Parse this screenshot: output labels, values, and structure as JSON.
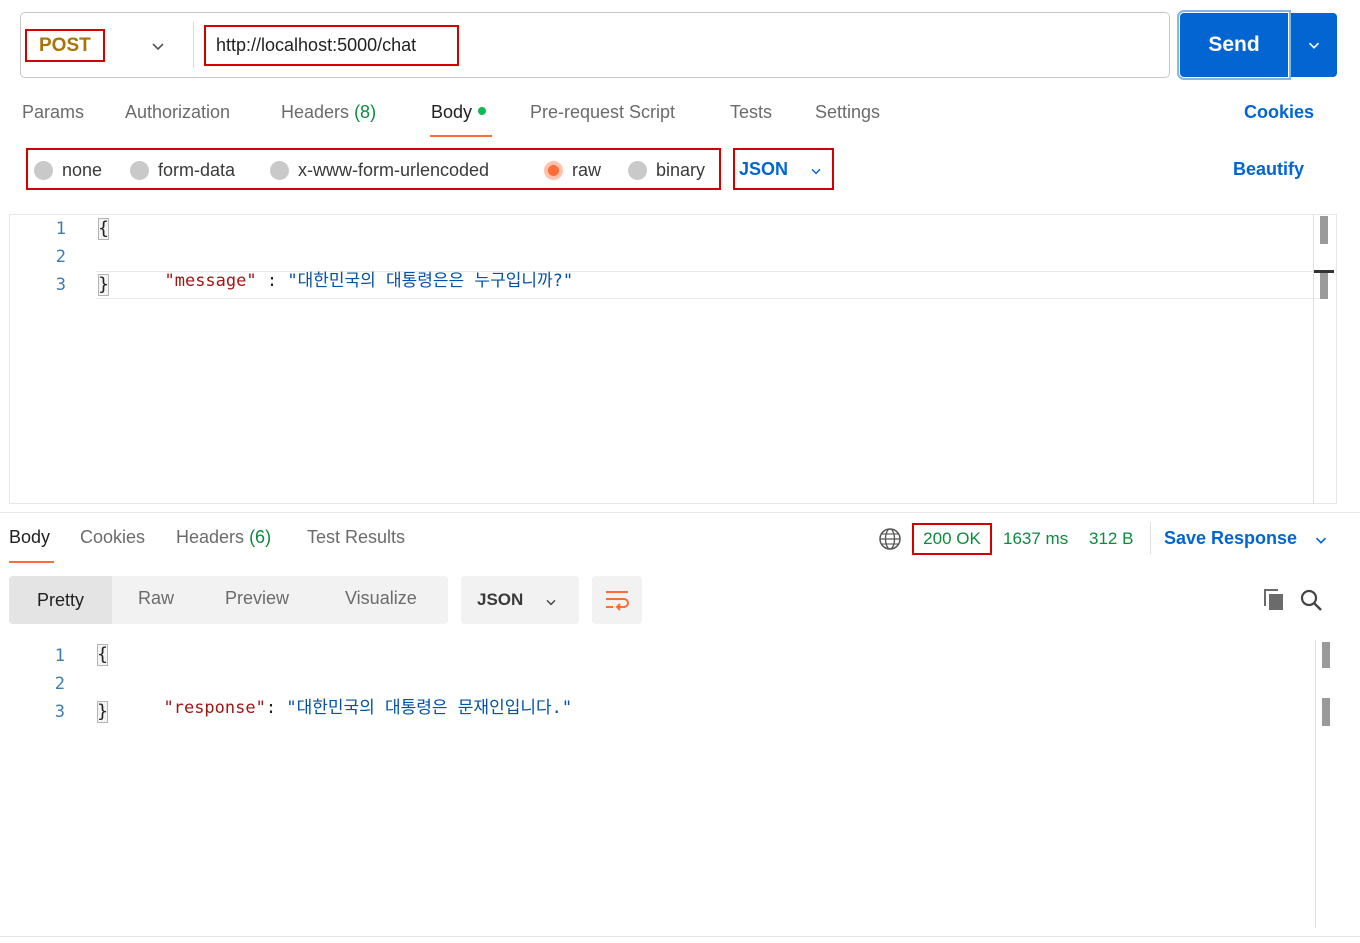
{
  "request": {
    "method": "POST",
    "url": "http://localhost:5000/chat",
    "send_label": "Send"
  },
  "request_tabs": [
    {
      "label": "Params"
    },
    {
      "label": "Authorization"
    },
    {
      "label": "Headers",
      "count": "(8)"
    },
    {
      "label": "Body"
    },
    {
      "label": "Pre-request Script"
    },
    {
      "label": "Tests"
    },
    {
      "label": "Settings"
    }
  ],
  "cookies_label": "Cookies",
  "body_types": [
    {
      "label": "none",
      "selected": false
    },
    {
      "label": "form-data",
      "selected": false
    },
    {
      "label": "x-www-form-urlencoded",
      "selected": false
    },
    {
      "label": "raw",
      "selected": true
    },
    {
      "label": "binary",
      "selected": false
    }
  ],
  "body_format": "JSON",
  "beautify_label": "Beautify",
  "request_body": {
    "line_numbers": [
      "1",
      "2",
      "3"
    ],
    "open_brace": "{",
    "close_brace": "}",
    "key": "\"message\"",
    "sep": " : ",
    "value": "\"대한민국의 대통령은은 누구입니까?\""
  },
  "response_tabs": [
    {
      "label": "Body"
    },
    {
      "label": "Cookies"
    },
    {
      "label": "Headers",
      "count": "(6)"
    },
    {
      "label": "Test Results"
    }
  ],
  "response_meta": {
    "status": "200 OK",
    "time": "1637 ms",
    "size": "312 B",
    "save_label": "Save Response"
  },
  "view_modes": [
    "Pretty",
    "Raw",
    "Preview",
    "Visualize"
  ],
  "response_format": "JSON",
  "response_body": {
    "line_numbers": [
      "1",
      "2",
      "3"
    ],
    "open_brace": "{",
    "close_brace": "}",
    "key": "\"response\"",
    "sep": ": ",
    "value": "\"대한민국의 대통령은 문재인입니다.\""
  },
  "colors": {
    "accent": "#ff6c37",
    "send_blue": "#0265d2",
    "success_green": "#0c8a3d",
    "method_post": "#a77505",
    "highlight_box": "#d40000"
  },
  "icons": [
    "chevron-down-icon",
    "globe-icon",
    "wrap-lines-icon",
    "copy-icon",
    "search-icon"
  ]
}
